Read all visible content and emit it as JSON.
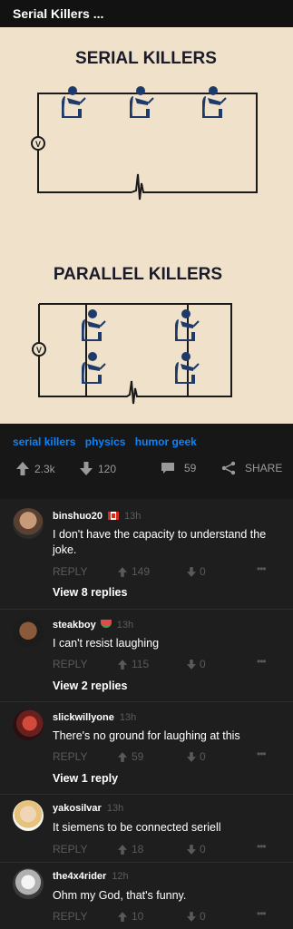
{
  "header": {
    "title": "Serial Killers ..."
  },
  "meme": {
    "top_label": "SERIAL KILLERS",
    "bottom_label": "PARALLEL KILLERS",
    "meter_symbol": "V"
  },
  "tags": [
    "serial killers",
    "physics",
    "humor geek"
  ],
  "actions": {
    "upvotes": "2.3k",
    "downvotes": "120",
    "comments": "59",
    "share": "SHARE"
  },
  "comments": [
    {
      "user": "binshuo20",
      "time": "13h",
      "text": "I don't have the capacity to understand the joke.",
      "reply_label": "REPLY",
      "up": "149",
      "down": "0",
      "more": "•••",
      "view_replies": "View 8 replies"
    },
    {
      "user": "steakboy",
      "time": "13h",
      "text": "I can't resist laughing",
      "reply_label": "REPLY",
      "up": "115",
      "down": "0",
      "more": "•••",
      "view_replies": "View 2 replies"
    },
    {
      "user": "slickwillyone",
      "time": "13h",
      "text": "There's no ground for laughing at this",
      "reply_label": "REPLY",
      "up": "59",
      "down": "0",
      "more": "•••",
      "view_replies": "View 1 reply"
    },
    {
      "user": "yakosilvar",
      "time": "13h",
      "text": "It siemens to be connected seriell",
      "reply_label": "REPLY",
      "up": "18",
      "down": "0",
      "more": "•••"
    },
    {
      "user": "the4x4rider",
      "time": "12h",
      "text": "Ohm my God, that's funny.",
      "reply_label": "REPLY",
      "up": "10",
      "down": "0",
      "more": "•••"
    }
  ],
  "colors": {
    "accent": "#0a84ff",
    "background": "#1e1e1e",
    "meme_bg": "#efe1ca",
    "figure": "#1d3a6a"
  }
}
